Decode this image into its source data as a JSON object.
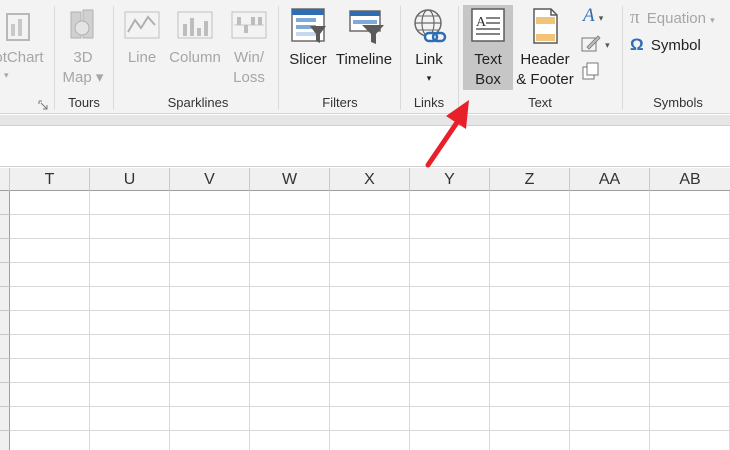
{
  "ribbon": {
    "pivotchart": {
      "label": "otChart"
    },
    "map3d": {
      "line1": "3D",
      "line2": "Map"
    },
    "sparklines": {
      "line": "Line",
      "column": "Column",
      "winloss1": "Win/",
      "winloss2": "Loss"
    },
    "filters": {
      "slicer": "Slicer",
      "timeline": "Timeline"
    },
    "links": {
      "link": "Link"
    },
    "text": {
      "textbox1": "Text",
      "textbox2": "Box",
      "header1": "Header",
      "header2": "& Footer"
    },
    "symbols": {
      "equation": "Equation",
      "symbol": "Symbol"
    },
    "groups": {
      "tours": "Tours",
      "sparklines": "Sparklines",
      "filters": "Filters",
      "links": "Links",
      "text": "Text",
      "symbols": "Symbols"
    }
  },
  "sheet": {
    "columns": [
      "T",
      "U",
      "V",
      "W",
      "X",
      "Y",
      "Z",
      "AA",
      "AB"
    ]
  },
  "colors": {
    "arrow": "#e8202a",
    "selected": "#c6c6c6",
    "accent": "#2b6cb0"
  }
}
